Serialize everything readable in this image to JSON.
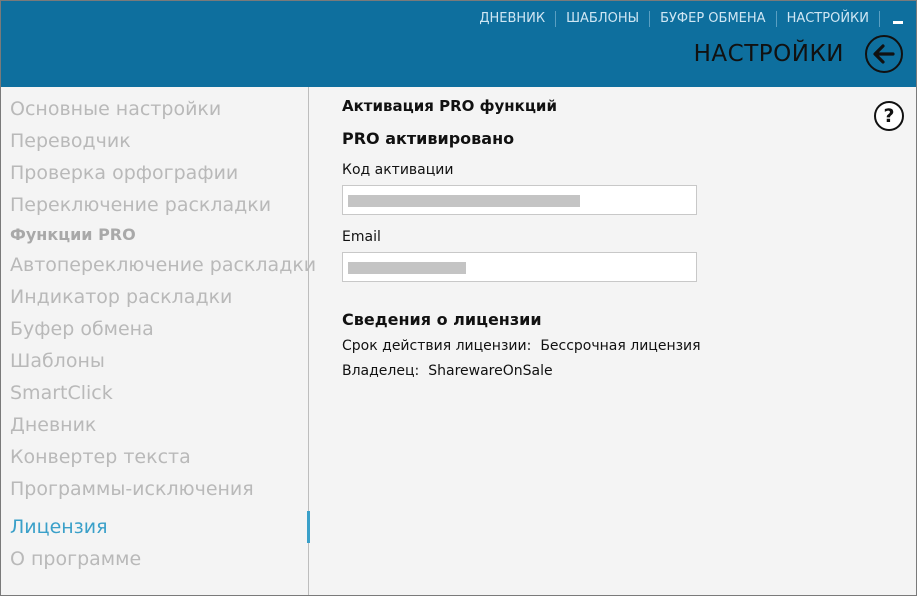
{
  "topnav": {
    "items": [
      "ДНЕВНИК",
      "ШАБЛОНЫ",
      "БУФЕР ОБМЕНА",
      "НАСТРОЙКИ"
    ]
  },
  "header": {
    "title": "НАСТРОЙКИ"
  },
  "sidebar": {
    "items": [
      "Основные настройки",
      "Переводчик",
      "Проверка орфографии",
      "Переключение раскладки",
      "Функции PRO",
      "Автопереключение раскладки",
      "Индикатор раскладки",
      "Буфер обмена",
      "Шаблоны",
      "SmartClick",
      "Дневник",
      "Конвертер текста",
      "Программы-исключения",
      "Лицензия",
      "О программе"
    ]
  },
  "content": {
    "section_title": "Активация PRO функций",
    "pro_status": "PRO активировано",
    "activation_label": "Код активации",
    "email_label": "Email",
    "license_title": "Сведения о лицензии",
    "license_term_label": "Срок действия лицензии:",
    "license_term_value": "Бессрочная лицензия",
    "owner_label": "Владелец:",
    "owner_value": "SharewareOnSale"
  },
  "help": {
    "label": "?"
  },
  "colors": {
    "header_bg": "#0e6f9e",
    "accent": "#3aa0c9",
    "sidebar_text": "#b9b9b9"
  }
}
